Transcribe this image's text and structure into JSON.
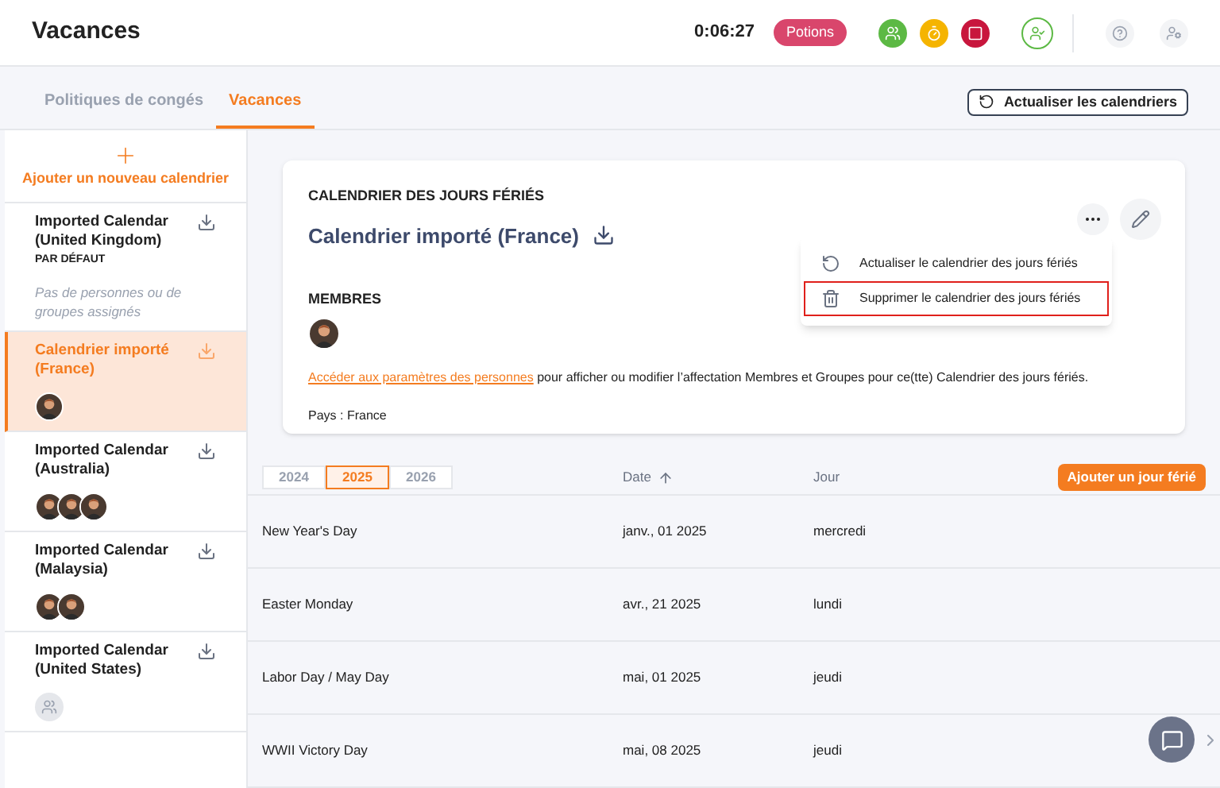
{
  "header": {
    "title": "Vacances",
    "timer": "0:06:27",
    "badge": "Potions",
    "status_buttons": [
      {
        "kind": "people",
        "color": "#5cb944"
      },
      {
        "kind": "stopwatch",
        "color": "#f5b400"
      },
      {
        "kind": "stop",
        "color": "#c8163d"
      }
    ],
    "tool_buttons": [
      {
        "kind": "user-check"
      },
      {
        "kind": "help"
      },
      {
        "kind": "users-settings"
      }
    ]
  },
  "tabs": [
    {
      "label": "Politiques de congés",
      "selected": false
    },
    {
      "label": "Vacances",
      "selected": true
    }
  ],
  "refresh_button": "Actualiser les calendriers",
  "sidebar": {
    "add_label": "Ajouter un nouveau calendrier",
    "items": [
      {
        "name": "Imported Calendar (United Kingdom)",
        "default_label": "PAR DÉFAUT",
        "note": "Pas de personnes ou de groupes assignés",
        "selected": false
      },
      {
        "name": "Calendrier importé (France)",
        "selected": true
      },
      {
        "name": "Imported Calendar (Australia)",
        "selected": false
      },
      {
        "name": "Imported Calendar (Malaysia)",
        "selected": false
      },
      {
        "name": "Imported Calendar (United States)",
        "selected": false,
        "avatars": [
          {
            "kind": "placeholder"
          }
        ]
      }
    ]
  },
  "card": {
    "heading": "CALENDRIER DES JOURS FÉRIÉS",
    "title": "Calendrier importé (France)",
    "members_heading": "MEMBRES",
    "link": "Accéder aux paramètres des personnes",
    "sentence": " pour afficher ou modifier l’affectation Membres et Groupes pour ce(tte) Calendrier des jours fériés.",
    "country": "Pays : France",
    "menu": [
      {
        "kind": "refresh",
        "label": "Actualiser le calendrier des jours fériés",
        "selected": false
      },
      {
        "kind": "trash",
        "label": "Supprimer le calendrier des jours fériés",
        "selected": true
      }
    ]
  },
  "table": {
    "years": [
      {
        "label": "2024",
        "selected": false
      },
      {
        "label": "2025",
        "selected": true
      },
      {
        "label": "2026",
        "selected": false
      }
    ],
    "columns": [
      "Date",
      "Jour"
    ],
    "add_button": "Ajouter un jour férié",
    "rows": [
      {
        "name": "New Year's Day",
        "date": "janv., 01 2025",
        "day": "mercredi"
      },
      {
        "name": "Easter Monday",
        "date": "avr., 21 2025",
        "day": "lundi"
      },
      {
        "name": "Labor Day / May Day",
        "date": "mai, 01 2025",
        "day": "jeudi"
      },
      {
        "name": "WWII Victory Day",
        "date": "mai, 08 2025",
        "day": "jeudi"
      }
    ]
  }
}
